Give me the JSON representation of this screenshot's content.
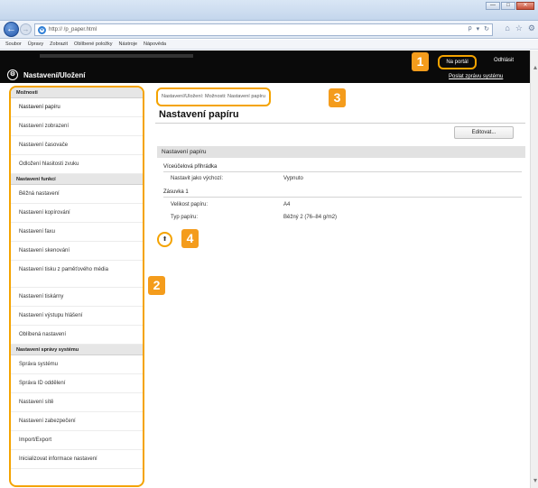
{
  "browser": {
    "window_controls": [
      "—",
      "□",
      "✕"
    ],
    "address_url": "http://                    /p_paper.html",
    "address_tools": [
      "ρ",
      "▾",
      "↻"
    ],
    "nav_icons": [
      "⌂",
      "☆",
      "⚙"
    ],
    "back_icon": "arrow-left-icon",
    "ie_icon": "ie-logo-icon"
  },
  "menu": [
    "Soubor",
    "Úpravy",
    "Zobrazit",
    "Oblíbené položky",
    "Nástroje",
    "Nápověda"
  ],
  "app": {
    "title": "Nastavení/Uložení",
    "portal_button": "Na portál",
    "logout_link": "Odhlásit",
    "send_message_link": "Poslat zprávu systému",
    "accent_color": "#f4a300"
  },
  "callouts": [
    "1",
    "2",
    "3",
    "4"
  ],
  "sidebar": {
    "sections": [
      {
        "title": "Možnosti",
        "items": [
          "Nastavení papíru",
          "Nastavení zobrazení",
          "Nastavení časovače",
          "Odložení hlasitosti zvuku"
        ]
      },
      {
        "title": "Nastavení funkcí",
        "items": [
          "Běžná nastavení",
          "Nastavení kopírování",
          "Nastavení faxu",
          "Nastavení skenování",
          "Nastavení tisku z paměťového média",
          "Nastavení tiskárny",
          "Nastavení výstupu hlášení",
          "Oblíbená nastavení"
        ]
      },
      {
        "title": "Nastavení správy systému",
        "items": [
          "Správa systému",
          "Správa ID oddělení",
          "Nastavení sítě",
          "Nastavení zabezpečení",
          "Import/Export",
          "Inicializovat informace nastavení"
        ]
      }
    ]
  },
  "main": {
    "breadcrumb": "Nastavení/Uložení: Možnosti: Nastavení papíru",
    "page_title": "Nastavení papíru",
    "edit_button": "Editovat...",
    "panel_title": "Nastavení papíru",
    "groups": [
      {
        "title": "Víceúčelová přihrádka",
        "rows": [
          {
            "label": "Nastavit jako výchozí:",
            "value": "Vypnuto"
          }
        ]
      },
      {
        "title": "Zásuvka 1",
        "rows": [
          {
            "label": "Velikost papíru:",
            "value": "A4"
          },
          {
            "label": "Typ papíru:",
            "value": "Běžný 2 (76–84 g/m2)"
          }
        ]
      }
    ],
    "back_to_top_icon": "arrow-up-icon"
  }
}
